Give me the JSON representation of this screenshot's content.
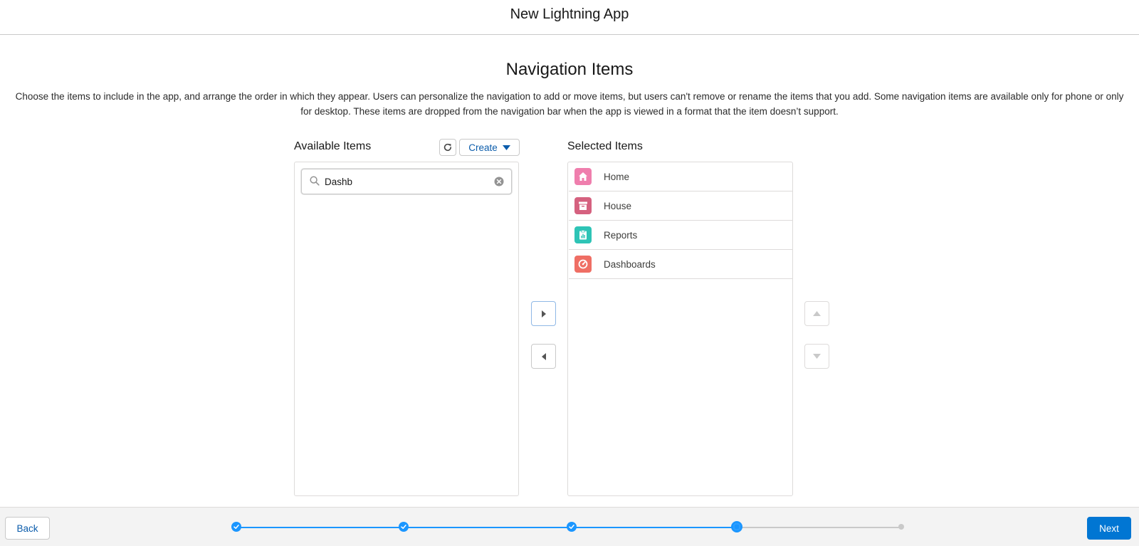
{
  "header": {
    "title": "New Lightning App"
  },
  "step": {
    "title": "Navigation Items",
    "description": "Choose the items to include in the app, and arrange the order in which they appear. Users can personalize the navigation to add or move items, but users can't remove or rename the items that you add. Some navigation items are available only for phone or only for desktop. These items are dropped from the navigation bar when the app is viewed in a format that the item doesn’t support."
  },
  "available": {
    "label": "Available Items",
    "create_label": "Create",
    "refresh_icon": "refresh-icon",
    "search": {
      "value": "Dashb",
      "placeholder": ""
    }
  },
  "selected": {
    "label": "Selected Items",
    "items": [
      {
        "label": "Home",
        "icon": "home-icon",
        "color": "#ef7ead"
      },
      {
        "label": "House",
        "icon": "archive-icon",
        "color": "#d5617f"
      },
      {
        "label": "Reports",
        "icon": "reports-icon",
        "color": "#2ec4b6"
      },
      {
        "label": "Dashboards",
        "icon": "dashboard-icon",
        "color": "#ef6e64"
      }
    ]
  },
  "footer": {
    "back_label": "Back",
    "next_label": "Next",
    "progress": {
      "total_steps": 5,
      "current_step": 4
    }
  },
  "colors": {
    "brand": "#0176d3",
    "progress": "#1b96ff",
    "link": "#0b5cab"
  }
}
